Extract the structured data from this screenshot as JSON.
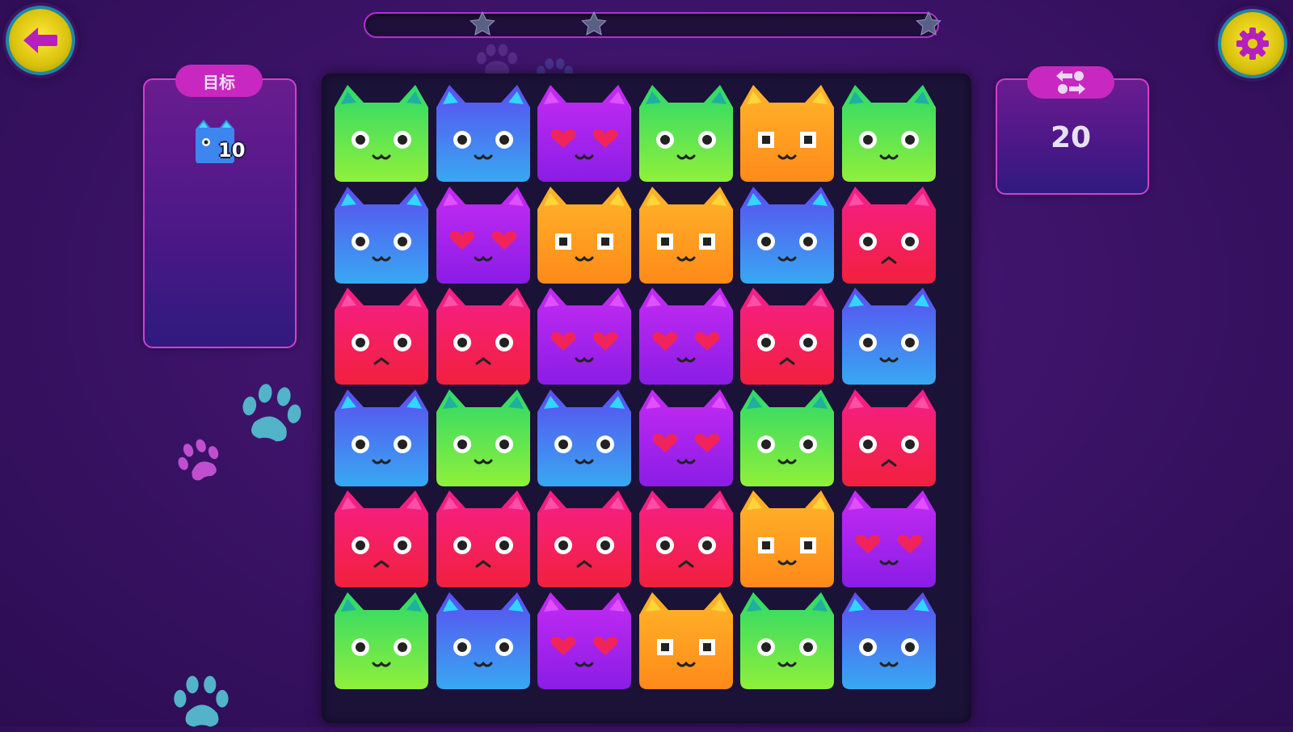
{
  "hud": {
    "back_icon": "arrow-left-icon",
    "settings_icon": "gear-icon",
    "score_progress": 0.0,
    "star_count": 3,
    "star_color": "#5a5f86"
  },
  "goal_panel": {
    "title": "目标",
    "target_icon": "blue-cat-icon",
    "target_count": "10"
  },
  "moves_panel": {
    "icon": "swap-icon",
    "count": "20"
  },
  "colors": {
    "green": "#6ef03a",
    "blue": "#3d86f0",
    "purple": "#a521ef",
    "orange": "#ff9a1f",
    "red": "#f2205a"
  },
  "board": {
    "columns": 6,
    "rows": [
      [
        "green",
        "blue",
        "purple",
        "green",
        "orange",
        "green"
      ],
      [
        "blue",
        "purple",
        "orange",
        "orange",
        "blue",
        "red"
      ],
      [
        "red",
        "red",
        "purple",
        "purple",
        "red",
        "blue"
      ],
      [
        "blue",
        "green",
        "blue",
        "purple",
        "green",
        "red"
      ],
      [
        "red",
        "red",
        "red",
        "red",
        "orange",
        "purple"
      ],
      [
        "green",
        "blue",
        "purple",
        "orange",
        "green",
        "blue"
      ]
    ]
  }
}
